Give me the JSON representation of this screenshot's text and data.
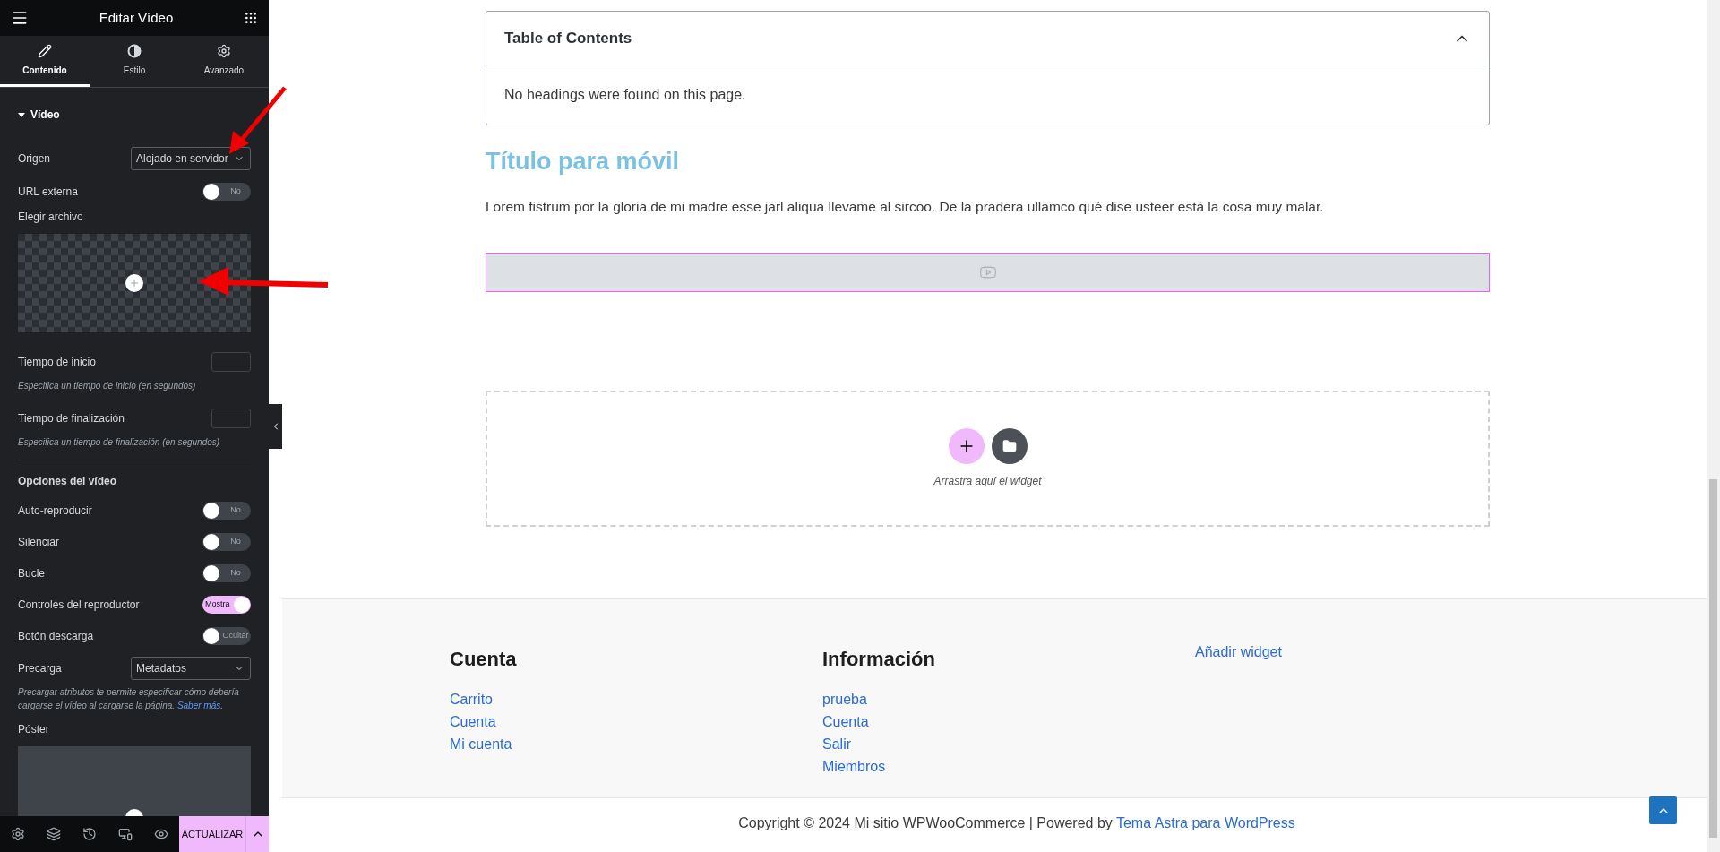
{
  "panel": {
    "title": "Editar Vídeo",
    "tabs": [
      {
        "label": "Contenido",
        "selected": true
      },
      {
        "label": "Estilo",
        "selected": false
      },
      {
        "label": "Avanzado",
        "selected": false
      }
    ],
    "section": {
      "title": "Vídeo",
      "expanded": true
    },
    "controls": [
      {
        "kind": "select",
        "label": "Origen",
        "value": "Alojado en servidor"
      },
      {
        "kind": "switch",
        "label": "URL externa",
        "on": false,
        "state_text": "No"
      },
      {
        "kind": "media",
        "label": "Elegir archivo"
      },
      {
        "kind": "number",
        "label": "Tiempo de inicio"
      },
      {
        "kind": "hint",
        "text": "Especifica un tiempo de inicio (en segundos)"
      },
      {
        "kind": "number",
        "label": "Tiempo de finalización"
      },
      {
        "kind": "hint",
        "text": "Especifica un tiempo de finalización (en segundos)"
      },
      {
        "kind": "heading",
        "text": "Opciones del vídeo"
      },
      {
        "kind": "switch",
        "label": "Auto-reproducir",
        "on": false,
        "state_text": "No"
      },
      {
        "kind": "switch",
        "label": "Silenciar",
        "on": false,
        "state_text": "No"
      },
      {
        "kind": "switch",
        "label": "Bucle",
        "on": false,
        "state_text": "No"
      },
      {
        "kind": "switch",
        "label": "Controles del reproductor",
        "on": true,
        "state_text": "Mostra"
      },
      {
        "kind": "switch",
        "label": "Botón descarga",
        "on": false,
        "state_text": "Ocultar"
      },
      {
        "kind": "select",
        "label": "Precarga",
        "value": "Metadatos"
      },
      {
        "kind": "hint",
        "text": "Precargar atributos te permite especificar cómo debería cargarse el vídeo al cargarse la página.",
        "link": "Saber más",
        "after": "."
      },
      {
        "kind": "poster",
        "label": "Póster"
      }
    ],
    "footer": {
      "update": "ACTUALIZAR"
    }
  },
  "page": {
    "toc": {
      "title": "Table of Contents",
      "expanded": true,
      "empty_text": "No headings were found on this page."
    },
    "heading": "Título para móvil",
    "paragraph": "Lorem fistrum por la gloria de mi madre esse jarl aliqua llevame al sircoo. De la pradera ullamco qué dise usteer está la cosa muy malar.",
    "dropzone": {
      "text": "Arrastra aquí el widget"
    }
  },
  "footer": {
    "columns": [
      {
        "title": "Cuenta",
        "links": [
          "Carrito",
          "Cuenta",
          "Mi cuenta"
        ]
      },
      {
        "title": "Información",
        "links": [
          "prueba",
          "Cuenta",
          "Salir",
          "Miembros"
        ]
      },
      {
        "links": [
          "Añadir widget"
        ]
      }
    ],
    "copyright": "Copyright © 2024 Mi sitio WPWooCommerce | Powered by ",
    "credit_link": "Tema Astra para WordPress"
  }
}
